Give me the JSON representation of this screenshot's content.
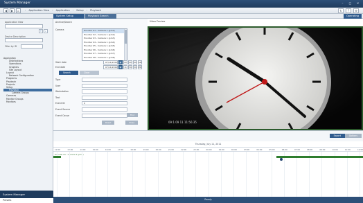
{
  "window": {
    "title": "System Manager"
  },
  "breadcrumbs": [
    "Application View",
    "Application",
    "Setup",
    "Playback"
  ],
  "toolbar": {
    "back_icon": "back-arrow",
    "forward_icon": "forward-arrow",
    "home_icon": "home"
  },
  "tabs": [
    {
      "label": "System Setup"
    },
    {
      "label": "Playback Search"
    }
  ],
  "tab_right": "Operating",
  "sidebar": {
    "label_app_view": "Application View",
    "label_description": "Device Description",
    "label_filter": "Filter by ID",
    "tree": [
      {
        "label": "Application",
        "level": 0
      },
      {
        "label": "Distributions",
        "level": 2
      },
      {
        "label": "Operations",
        "level": 2
      },
      {
        "label": "Graphics",
        "level": 2
      },
      {
        "label": "Site Layout",
        "level": 2
      },
      {
        "label": "Layout",
        "level": 1
      },
      {
        "label": "Network Configuration",
        "level": 2
      },
      {
        "label": "Programs",
        "level": 1
      },
      {
        "label": "Playback",
        "level": 1
      },
      {
        "label": "Projects",
        "level": 1
      },
      {
        "label": "Setup",
        "level": 1
      },
      {
        "label": "Playback",
        "level": 2,
        "selected": true
      },
      {
        "label": "Camera Groups",
        "level": 3
      },
      {
        "label": "Cameras",
        "level": 1
      },
      {
        "label": "Monitor Groups",
        "level": 1
      },
      {
        "label": "Monitors",
        "level": 1
      }
    ],
    "footer": "System Manager",
    "bottom": "Presets"
  },
  "form": {
    "section_label": "Archive/Search",
    "camera_label": "Camera",
    "cameras": [
      "Encoder 01 - Camera 1 (pm1)",
      "Encoder 02 - Camera 1 (pm2)",
      "Encoder 03 - Camera 1 (pm3)",
      "Encoder 04 - Camera 1 (pm4)",
      "Encoder 05 - Camera 1 (pm5)",
      "Encoder 06 - Camera 1 (pm6)",
      "Encoder 07 - Camera 1 (pm7)",
      "Encoder 08 - Camera 1 (pm8)"
    ],
    "start_label": "Start date",
    "end_label": "End date",
    "start_date": "07/11/2011",
    "end_date": "07/11/2011",
    "start_time": [
      "00",
      "00",
      "00",
      "AM"
    ],
    "end_time": [
      "11",
      "59",
      "59",
      "PM"
    ],
    "btn_search": "Search",
    "btn_clear": "Clear Form",
    "fields": [
      "Type",
      "User",
      "Workstation",
      "Text",
      "Event ID",
      "Event Source",
      "Event Cause"
    ],
    "event_id_value": "0",
    "btn_find": "Find",
    "btn_reset": "Reset",
    "btn_close": "Close"
  },
  "video": {
    "label": "Video Preview",
    "timestamp": "09:1 09 11 11:56:35"
  },
  "timeline": {
    "btn_export": "Export",
    "btn_options": "Options",
    "date": "Thursday, July 11, 2011",
    "ticks": [
      "12:00",
      "13:00",
      "14:00",
      "15:00",
      "16:00",
      "17:00",
      "18:00",
      "19:00",
      "20:00",
      "21:00",
      "22:00",
      "23:00",
      "00:00",
      "01:00",
      "02:00",
      "03:00",
      "04:00",
      "05:00",
      "06:00",
      "07:00",
      "08:00",
      "09:00",
      "10:00",
      "11:00",
      "12:00"
    ],
    "camera_row": "Encoder 01 - Camera 1 (pm1)",
    "recordings": [
      {
        "start": 0.0,
        "end": 0.025
      },
      {
        "start": 0.72,
        "end": 1.0
      }
    ],
    "playhead": 0.735
  },
  "statusbar": "Ready",
  "colors": {
    "accent": "#2f5b8d",
    "title": "#1f3b5d",
    "recording": "#2e7d2e",
    "video_border": "#2b5a2b"
  }
}
